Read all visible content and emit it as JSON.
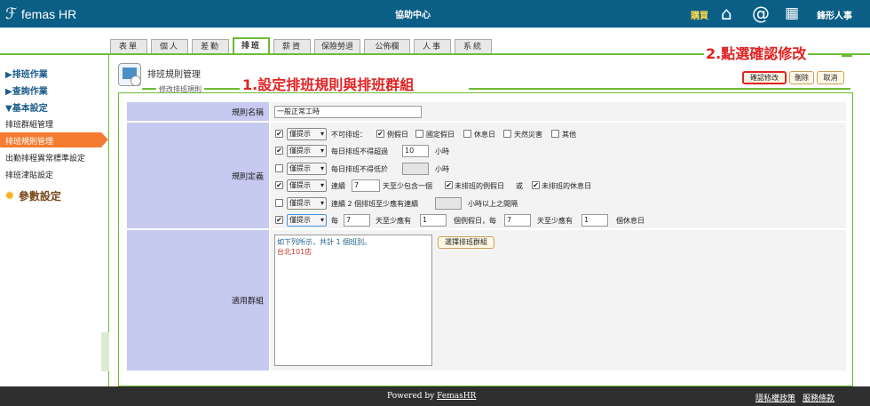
{
  "header": {
    "logo": "femas HR",
    "center_title": "協助中心",
    "buy": "購買",
    "user": "鋒形人事",
    "icons": [
      "home-icon",
      "at-icon",
      "calendar-icon"
    ]
  },
  "tabs": [
    "表單",
    "個人",
    "差勤",
    "排班",
    "薪資",
    "保險勞退",
    "公佈欄",
    "人事",
    "系統"
  ],
  "active_tab": "排班",
  "sidebar": {
    "sections": [
      "▶排班作業",
      "▶查詢作業",
      "▼基本設定"
    ],
    "items": [
      "排班群組管理",
      "排班規則管理",
      "出勤排程異常標準設定",
      "排班津貼設定"
    ],
    "active_item": "排班規則管理",
    "settings": "參數設定"
  },
  "page": {
    "title": "排班規則管理",
    "subtitle": "修改排班規則"
  },
  "annotations": {
    "step1": "1.設定排班規則與排班群組",
    "step2": "2.點選確認修改"
  },
  "buttons": {
    "confirm": "確認修改",
    "delete": "刪除",
    "cancel": "取消"
  },
  "form": {
    "rule_name_label": "規則名稱",
    "rule_name_value": "一般正常工時",
    "definition_label": "規則定義",
    "group_label": "適用群組",
    "select_value": "僅提示",
    "r1": {
      "text": "不可排班：",
      "opts": [
        "例假日",
        "國定假日",
        "休息日",
        "天然災害",
        "其他"
      ]
    },
    "r2": {
      "text": "每日排班不得超過",
      "value": "10",
      "unit": "小時"
    },
    "r3": {
      "text": "每日排班不得低於",
      "unit": "小時"
    },
    "r4": {
      "t1": "連續",
      "value": "7",
      "t2": "天至少包含一個",
      "opt1": "未排班的例假日",
      "or": "或",
      "opt2": "未排班的休息日"
    },
    "r5": {
      "text": "連續 2 個排班至少應有連續",
      "unit": "小時以上之間隔"
    },
    "r6": {
      "t1": "每",
      "v1": "7",
      "t2": "天至少應有",
      "v2": "1",
      "t3": "個例假日，每",
      "v3": "7",
      "t4": "天至少應有",
      "v4": "1",
      "t5": "個休息日"
    },
    "group_note": "如下列所示，共計 1 個班別。",
    "group_item": "台北101店",
    "choose_group": "選擇排班群組"
  },
  "footer": {
    "powered": "Powered by ",
    "brand": "FemasHR",
    "privacy": "隱私權政策",
    "terms": "服務條款"
  }
}
